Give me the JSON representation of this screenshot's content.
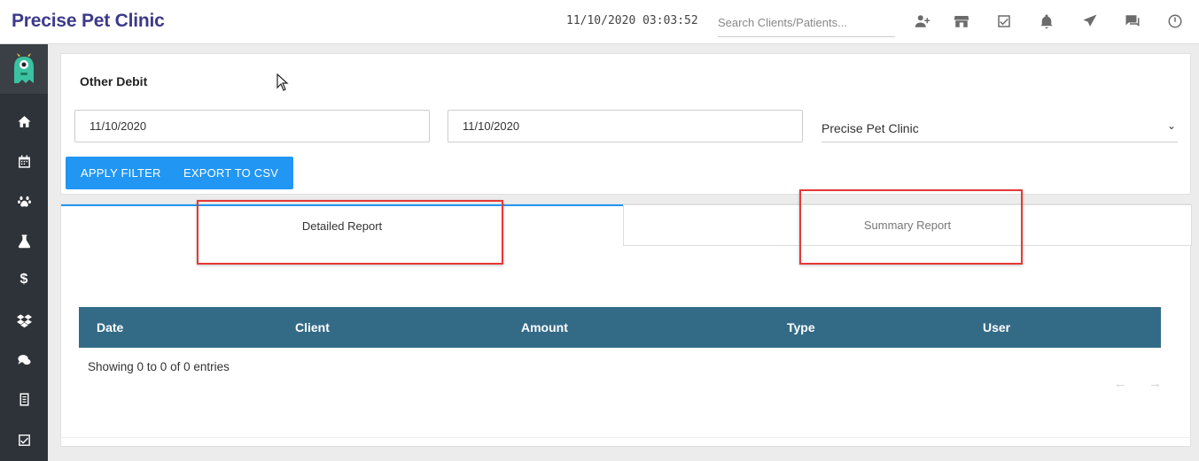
{
  "header": {
    "brand": "Precise Pet Clinic",
    "datetime": "11/10/2020 03:03:52",
    "search_placeholder": "Search Clients/Patients..."
  },
  "icons": {
    "top": [
      "add-client-icon",
      "store-icon",
      "checklist-icon",
      "bell-icon",
      "send-icon",
      "chat-icon",
      "clock-icon"
    ],
    "sidebar": [
      "monster-logo",
      "home-icon",
      "calendar-icon",
      "paw-icon",
      "lab-flask-icon",
      "dollar-icon",
      "dropbox-icon",
      "comments-icon",
      "report-icon",
      "checkbox-icon"
    ]
  },
  "filter": {
    "title": "Other Debit",
    "from_date": "11/10/2020",
    "to_date": "11/10/2020",
    "clinic": "Precise Pet Clinic",
    "apply_label": "APPLY FILTER",
    "export_label": "EXPORT TO CSV"
  },
  "tabs": {
    "detailed": "Detailed Report",
    "summary": "Summary Report"
  },
  "table": {
    "columns": [
      "Date",
      "Client",
      "Amount",
      "Type",
      "User"
    ],
    "rows": [],
    "info": "Showing 0 to 0 of 0 entries",
    "prev": "←",
    "next": "→"
  },
  "colors": {
    "brand": "#3d3a8a",
    "primary": "#2196f3",
    "table_header": "#336b87",
    "sidebar": "#2d3338",
    "highlight": "#e53935"
  }
}
